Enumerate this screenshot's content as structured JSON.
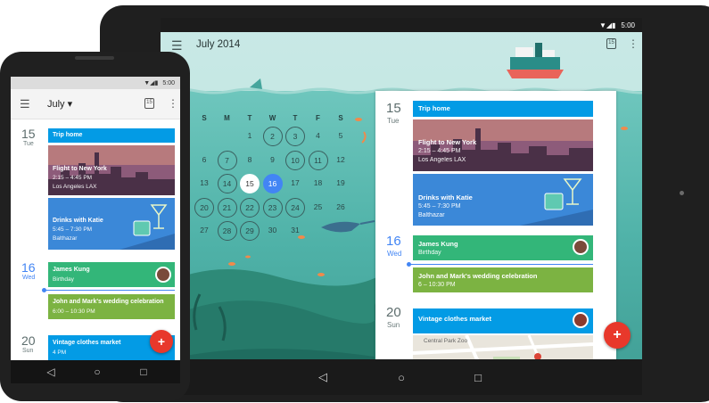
{
  "tablet": {
    "status_time": "5:00",
    "status_icons": "▼◢▮",
    "month_title": "July 2014",
    "weekdays": [
      "S",
      "M",
      "T",
      "W",
      "T",
      "F",
      "S"
    ],
    "weeks": [
      [
        "",
        "",
        "1",
        "2",
        "3",
        "4",
        "5"
      ],
      [
        "6",
        "7",
        "8",
        "9",
        "10",
        "11",
        "12"
      ],
      [
        "13",
        "14",
        "15",
        "16",
        "17",
        "18",
        "19"
      ],
      [
        "20",
        "21",
        "22",
        "23",
        "24",
        "25",
        "26"
      ],
      [
        "27",
        "28",
        "29",
        "30",
        "31",
        "",
        ""
      ]
    ],
    "today": "15",
    "selected": "16",
    "agenda": {
      "d15_num": "15",
      "d15_dow": "Tue",
      "trip_home": "Trip home",
      "flight_title": "Flight to New York",
      "flight_time": "2:15 – 4:45 PM",
      "flight_loc": "Los Angeles LAX",
      "drinks_title": "Drinks with Katie",
      "drinks_time": "5:45 – 7:30 PM",
      "drinks_loc": "Balthazar",
      "d16_num": "16",
      "d16_dow": "Wed",
      "james_title": "James Kung",
      "james_sub": "Birthday",
      "wedding_title": "John and Mark's wedding celebration",
      "wedding_time": "6 – 10:30 PM",
      "d20_num": "20",
      "d20_dow": "Sun",
      "vintage_title": "Vintage clothes market",
      "map_label": "Central Park Zoo"
    },
    "fab": "+",
    "nav": {
      "back": "◁",
      "home": "○",
      "recent": "□"
    }
  },
  "phone": {
    "status_time": "5:00",
    "status_icons": "▼◢▮",
    "month_title": "July ▾",
    "agenda": {
      "d15_num": "15",
      "d15_dow": "Tue",
      "trip_home": "Trip home",
      "flight_title": "Flight to New York",
      "flight_time": "2:15 – 4:45 PM",
      "flight_loc": "Los Angeles LAX",
      "drinks_title": "Drinks with Katie",
      "drinks_time": "5:45 – 7:30 PM",
      "drinks_loc": "Balthazar",
      "d16_num": "16",
      "d16_dow": "Wed",
      "james_title": "James Kung",
      "james_sub": "Birthday",
      "wedding_title": "John and Mark's wedding celebration",
      "wedding_time": "6:00 – 10:30 PM",
      "d20_num": "20",
      "d20_dow": "Sun",
      "vintage_title": "Vintage clothes market",
      "vintage_time": "4 PM"
    },
    "fab": "+",
    "nav": {
      "back": "◁",
      "home": "○",
      "recent": "□"
    }
  },
  "colors": {
    "event_blue": "#039be5",
    "event_green": "#33b679",
    "event_lime": "#7cb342",
    "selected_day": "#4285f4",
    "fab": "#e8382b"
  },
  "icons": [
    "menu-icon",
    "calendar-today-icon",
    "more-vert-icon",
    "back-icon",
    "home-icon",
    "recent-apps-icon",
    "add-icon"
  ]
}
